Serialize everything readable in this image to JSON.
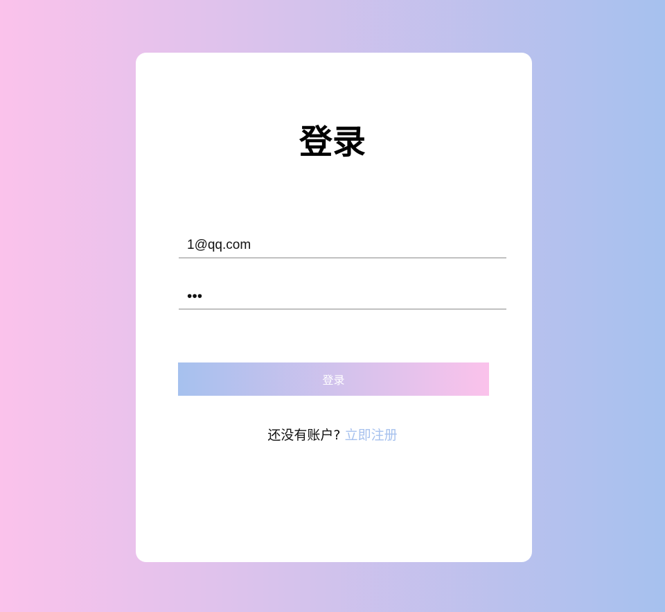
{
  "login": {
    "title": "登录",
    "email_value": "1@qq.com",
    "password_value": "123",
    "submit_label": "登录",
    "register_prompt": "还没有账户?",
    "register_link": "立即注册"
  },
  "colors": {
    "gradient_start": "#fbc2eb",
    "gradient_end": "#a6c1ee",
    "link": "#a6c1ee"
  }
}
